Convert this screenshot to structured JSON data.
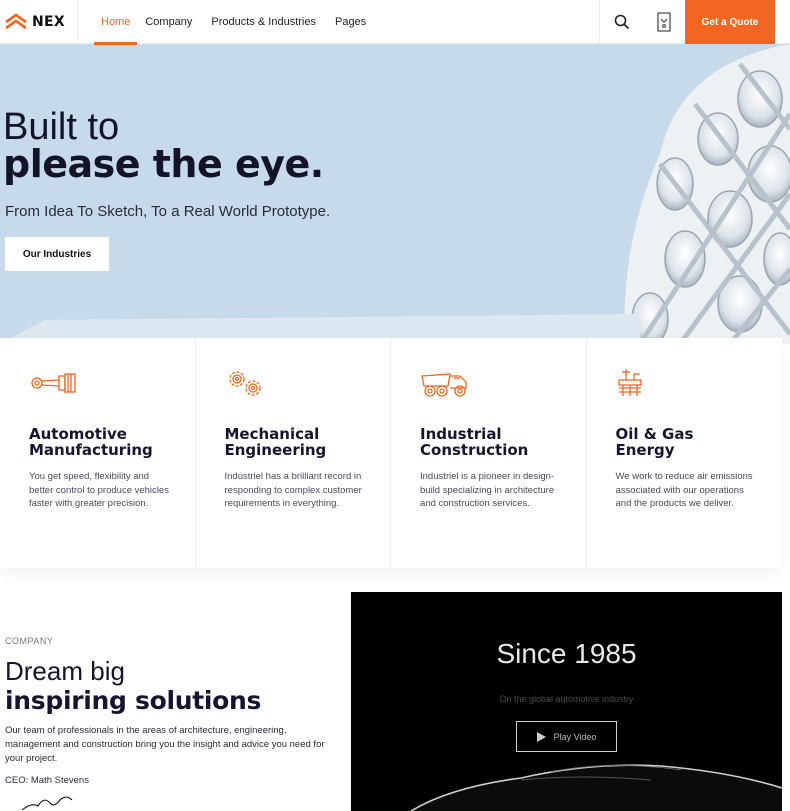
{
  "header": {
    "logo_text": "NEX",
    "nav": [
      "Home",
      "Company",
      "Products & Industries",
      "Pages"
    ],
    "active_nav": "Home",
    "quote_label": "Get a Quote"
  },
  "hero": {
    "title_light": "Built to",
    "title_bold": "please the eye.",
    "subtitle": "From Idea To Sketch, To a Real World Prototype.",
    "button_label": "Our Industries"
  },
  "services": [
    {
      "icon": "engine-piston-icon",
      "title_line1": "Automotive",
      "title_line2": "Manufacturing",
      "desc": "You get speed, flexibility and better control to produce vehicles faster with greater precision."
    },
    {
      "icon": "gears-icon",
      "title_line1": "Mechanical",
      "title_line2": "Engineering",
      "desc": "Industriel has a brilliant record in responding to complex customer requirements in everything."
    },
    {
      "icon": "dump-truck-icon",
      "title_line1": "Industrial",
      "title_line2": "Construction",
      "desc": "Industriel is a pioneer in design-build specializing in architecture and construction services."
    },
    {
      "icon": "oil-rig-icon",
      "title_line1": "Oil & Gas",
      "title_line2": "Energy",
      "desc": "We work to reduce air emissions associated with our operations and the products we deliver."
    }
  ],
  "company": {
    "label": "COMPANY",
    "title_light": "Dream big",
    "title_bold": "inspiring solutions",
    "text": "Our team of professionals in the areas of architecture, engineering, management and construction bring you the insight and advice you need for your project.",
    "ceo": "CEO: Math Stevens"
  },
  "video": {
    "title": "Since 1985",
    "subtitle": "On the global automotive industry",
    "button_label": "Play Video"
  },
  "colors": {
    "accent": "#f26522",
    "hero_bg": "#c6dae9",
    "dark": "#15152e"
  }
}
